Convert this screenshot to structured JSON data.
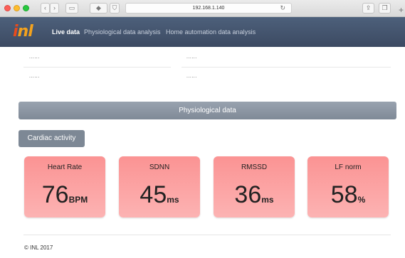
{
  "browser": {
    "address": "192.168.1.140",
    "reload_icon": "↻",
    "new_tab_icon": "+"
  },
  "navbar": {
    "logo_prefix": "i",
    "logo_rest": "nl",
    "links": [
      {
        "label": "Live data",
        "active": true
      },
      {
        "label": "Physiological data analysis",
        "active": false
      },
      {
        "label": "Home automation data analysis",
        "active": false
      }
    ]
  },
  "placeholders": [
    "......",
    "......",
    "......",
    "......"
  ],
  "section": {
    "title": "Physiological data",
    "subsection_button": "Cardiac activity"
  },
  "cards": [
    {
      "title": "Heart Rate",
      "value": "76",
      "unit": "BPM"
    },
    {
      "title": "SDNN",
      "value": "45",
      "unit": "ms"
    },
    {
      "title": "RMSSD",
      "value": "36",
      "unit": "ms"
    },
    {
      "title": "LF norm",
      "value": "58",
      "unit": "%"
    }
  ],
  "footer": {
    "text": "© INL 2017"
  },
  "colors": {
    "navbar": "#44546d",
    "card": "#fb9f9f",
    "section_bar": "#8c96a3",
    "logo_orange": "#f2a21e",
    "logo_red": "#e84b1c"
  }
}
